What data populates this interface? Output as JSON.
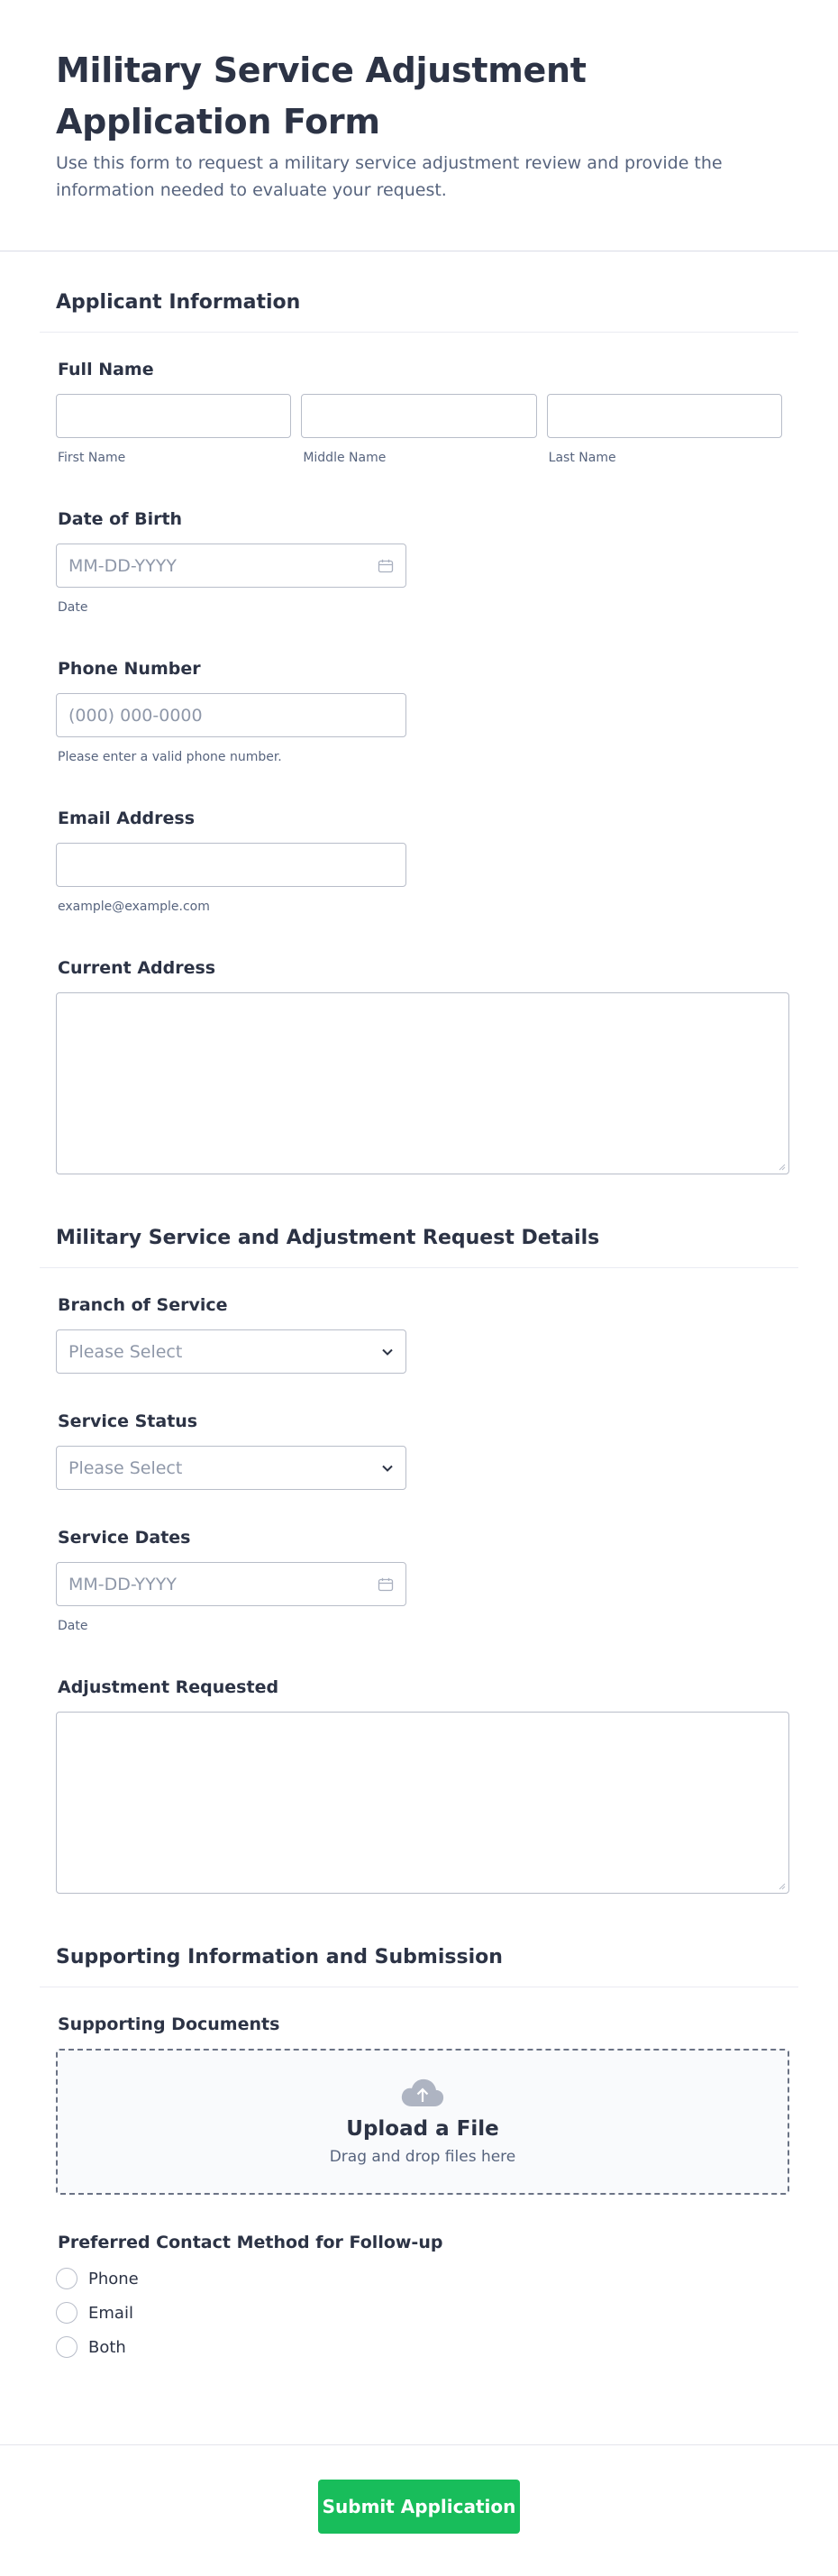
{
  "header": {
    "title": "Military Service Adjustment Application Form",
    "subtitle": "Use this form to request a military service adjustment review and provide the information needed to evaluate your request."
  },
  "section1": {
    "title": "Applicant Information",
    "full_name": {
      "label": "Full Name",
      "first_sublabel": "First Name",
      "middle_sublabel": "Middle Name",
      "last_sublabel": "Last Name"
    },
    "dob": {
      "label": "Date of Birth",
      "placeholder": "MM-DD-YYYY",
      "sublabel": "Date"
    },
    "phone": {
      "label": "Phone Number",
      "placeholder": "(000) 000-0000",
      "sublabel": "Please enter a valid phone number."
    },
    "email": {
      "label": "Email Address",
      "sublabel": "example@example.com"
    },
    "address": {
      "label": "Current Address"
    }
  },
  "section2": {
    "title": "Military Service and Adjustment Request Details",
    "branch": {
      "label": "Branch of Service",
      "placeholder": "Please Select"
    },
    "status": {
      "label": "Service Status",
      "placeholder": "Please Select"
    },
    "dates": {
      "label": "Service Dates",
      "placeholder": "MM-DD-YYYY",
      "sublabel": "Date"
    },
    "adjustment": {
      "label": "Adjustment Requested"
    }
  },
  "section3": {
    "title": "Supporting Information and Submission",
    "documents": {
      "label": "Supporting Documents",
      "upload_title": "Upload a File",
      "upload_sub": "Drag and drop files here"
    },
    "contact": {
      "label": "Preferred Contact Method for Follow-up",
      "options": [
        "Phone",
        "Email",
        "Both"
      ]
    }
  },
  "footer": {
    "submit_label": "Submit Application"
  },
  "colors": {
    "accent": "#18bd5b",
    "text": "#2c3345",
    "muted": "#57647e",
    "border": "#b8bdc9"
  }
}
